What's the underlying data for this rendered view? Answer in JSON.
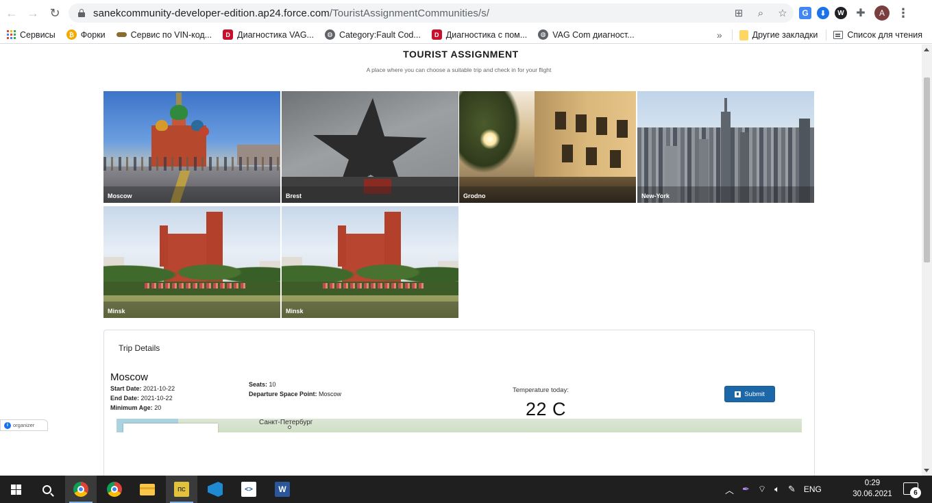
{
  "browser": {
    "url_host": "sanekcommunity-developer-edition.ap24.force.com",
    "url_path": "/TouristAssignmentCommunities/s/",
    "bookmarks": [
      {
        "label": "Сервисы",
        "icon": "apps-grid-icon"
      },
      {
        "label": "Форки",
        "icon": "bitcoin-icon",
        "color": "#f2a900"
      },
      {
        "label": "Сервис по VIN-код...",
        "icon": "car-icon",
        "color": "#8a6d2e"
      },
      {
        "label": "Диагностика VAG...",
        "icon": "d-logo-icon",
        "color": "#c8102e"
      },
      {
        "label": "Category:Fault Cod...",
        "icon": "globe-icon",
        "color": "#5f6368"
      },
      {
        "label": "Диагностика с пом...",
        "icon": "d-logo-icon",
        "color": "#c8102e"
      },
      {
        "label": "VAG Com диагност...",
        "icon": "globe-icon",
        "color": "#5f6368"
      }
    ],
    "more_bookmarks": "»",
    "other_bookmarks": "Другие закладки",
    "reading_list": "Список для чтения",
    "profile_initial": "A"
  },
  "page": {
    "title": "TOURIST ASSIGNMENT",
    "subtitle": "A place where you can choose a suitable trip and check in for your flight",
    "destinations": [
      {
        "name": "Moscow"
      },
      {
        "name": "Brest"
      },
      {
        "name": "Grodno"
      },
      {
        "name": "New-York"
      },
      {
        "name": "Minsk"
      },
      {
        "name": "Minsk"
      }
    ],
    "trip_details": {
      "card_title": "Trip Details",
      "city": "Moscow",
      "start_date_label": "Start Date:",
      "start_date": "2021-10-22",
      "end_date_label": "End Date:",
      "end_date": "2021-10-22",
      "min_age_label": "Minimum Age:",
      "min_age": "20",
      "seats_label": "Seats:",
      "seats": "10",
      "departure_label": "Departure Space Point:",
      "departure": "Moscow",
      "temperature_label": "Temperature today:",
      "temperature": "22 C",
      "submit_label": "Submit"
    },
    "map": {
      "city_label": "Санкт-Петербург"
    },
    "organizer_label": "organizer"
  },
  "taskbar": {
    "language": "ENG",
    "time": "0:29",
    "date": "30.06.2021",
    "notifications": "6"
  }
}
